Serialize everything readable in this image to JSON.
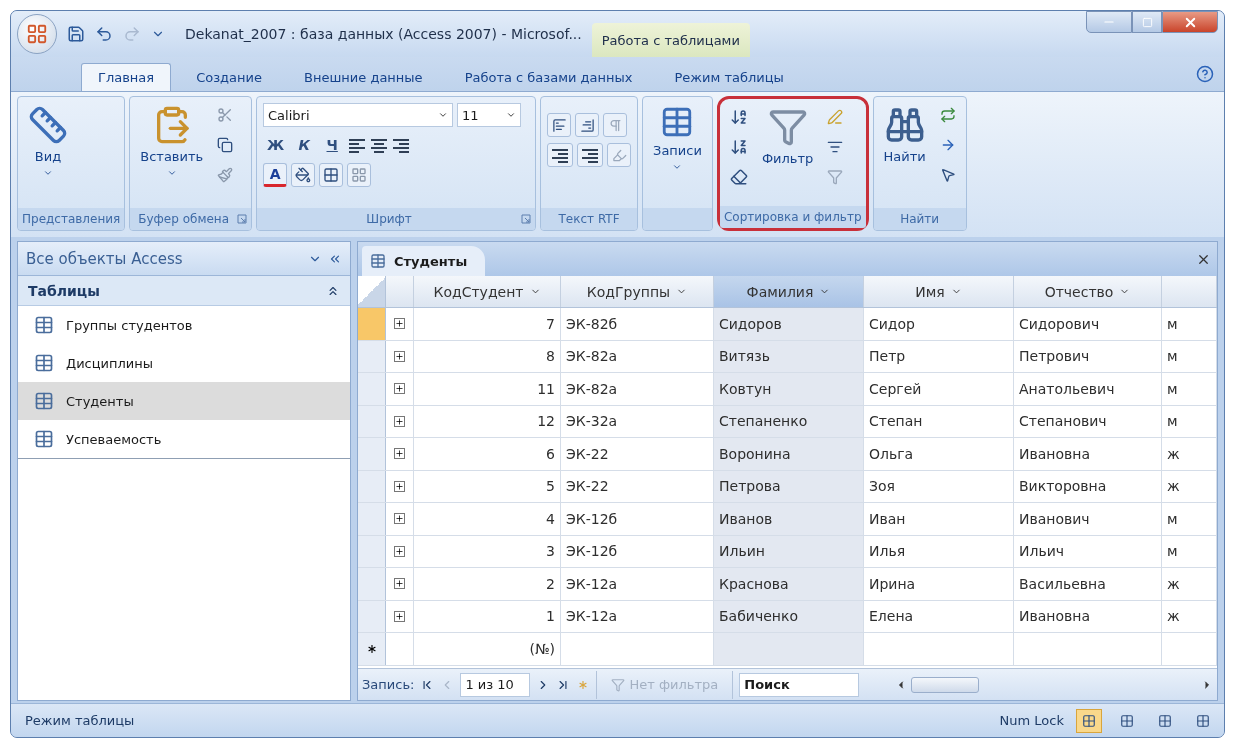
{
  "window": {
    "title": "Dekanat_2007 : база данных (Access 2007) - Microsof...",
    "context_tab": "Работа с таблицами"
  },
  "ribbon_tabs": [
    {
      "label": "Главная",
      "selected": true
    },
    {
      "label": "Создание",
      "selected": false
    },
    {
      "label": "Внешние данные",
      "selected": false
    },
    {
      "label": "Работа с базами данных",
      "selected": false
    },
    {
      "label": "Режим таблицы",
      "selected": false
    }
  ],
  "ribbon_groups": [
    {
      "kind": "view",
      "label": "Представления",
      "button": "Вид"
    },
    {
      "kind": "clipboard",
      "label": "Буфер обмена",
      "button": "Вставить"
    },
    {
      "kind": "font",
      "label": "Шрифт",
      "font_name": "Calibri",
      "font_size": "11",
      "style_buttons": [
        "Ж",
        "К",
        "Ч"
      ],
      "color_button": "A"
    },
    {
      "kind": "rtf",
      "label": "Текст RTF"
    },
    {
      "kind": "records",
      "button": "Записи"
    },
    {
      "kind": "sort_filter",
      "label": "Сортировка и фильтр",
      "button": "Фильтр",
      "highlighted": true
    },
    {
      "kind": "find",
      "label": "Найти",
      "button": "Найти"
    }
  ],
  "nav_pane": {
    "title": "Все объекты Access",
    "sections": [
      {
        "label": "Таблицы",
        "expanded": true,
        "items": [
          {
            "label": "Группы студентов",
            "selected": false
          },
          {
            "label": "Дисциплины",
            "selected": false
          },
          {
            "label": "Студенты",
            "selected": true
          },
          {
            "label": "Успеваемость",
            "selected": false
          }
        ]
      }
    ]
  },
  "document_tabs": [
    {
      "label": "Студенты"
    }
  ],
  "table": {
    "columns": [
      {
        "label": "КодСтудент",
        "kind": "number",
        "selected": false
      },
      {
        "label": "КодГруппы",
        "kind": "text",
        "selected": false
      },
      {
        "label": "Фамилия",
        "kind": "text",
        "selected": true
      },
      {
        "label": "Имя",
        "kind": "text",
        "selected": false
      },
      {
        "label": "Отчество",
        "kind": "text",
        "selected": false
      },
      {
        "kind": "text",
        "selected": false
      }
    ],
    "rows": [
      {
        "selected": true,
        "cells": [
          "7",
          "ЭК-82б",
          "Сидоров",
          "Сидор",
          "Сидорович",
          "м"
        ]
      },
      {
        "selected": false,
        "cells": [
          "8",
          "ЭК-82а",
          "Витязь",
          "Петр",
          "Петрович",
          "м"
        ]
      },
      {
        "selected": false,
        "cells": [
          "11",
          "ЭК-82а",
          "Ковтун",
          "Сергей",
          "Анатольевич",
          "м"
        ]
      },
      {
        "selected": false,
        "cells": [
          "12",
          "ЭК-32а",
          "Степаненко",
          "Степан",
          "Степанович",
          "м"
        ]
      },
      {
        "selected": false,
        "cells": [
          "6",
          "ЭК-22",
          "Воронина",
          "Ольга",
          "Ивановна",
          "ж"
        ]
      },
      {
        "selected": false,
        "cells": [
          "5",
          "ЭК-22",
          "Петрова",
          "Зоя",
          "Викторовна",
          "ж"
        ]
      },
      {
        "selected": false,
        "cells": [
          "4",
          "ЭК-12б",
          "Иванов",
          "Иван",
          "Иванович",
          "м"
        ]
      },
      {
        "selected": false,
        "cells": [
          "3",
          "ЭК-12б",
          "Ильин",
          "Илья",
          "Ильич",
          "м"
        ]
      },
      {
        "selected": false,
        "cells": [
          "2",
          "ЭК-12а",
          "Краснова",
          "Ирина",
          "Васильевна",
          "ж"
        ]
      },
      {
        "selected": false,
        "cells": [
          "1",
          "ЭК-12а",
          "Бабиченко",
          "Елена",
          "Ивановна",
          "ж"
        ]
      }
    ],
    "new_row": {
      "id_text": "(№)"
    }
  },
  "record_nav": {
    "label": "Запись:",
    "position": "1 из 10",
    "filter": {
      "label": "Нет фильтра",
      "disabled": true
    },
    "search": {
      "placeholder": "Поиск"
    }
  },
  "status_bar": {
    "text": "Режим таблицы",
    "indicator": "Num Lock",
    "views": [
      {
        "selected": true
      },
      {
        "selected": false
      },
      {
        "selected": false
      },
      {
        "selected": false
      }
    ]
  }
}
